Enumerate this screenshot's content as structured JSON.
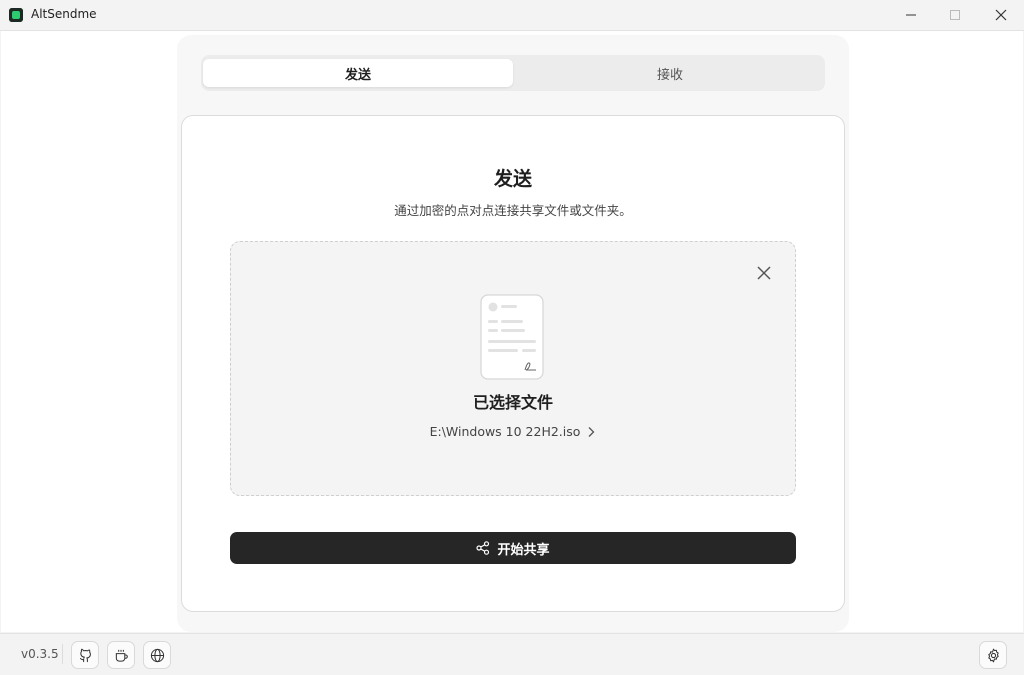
{
  "window": {
    "title": "AltSendme",
    "controls": {
      "minimize_icon": "minimize-icon",
      "maximize_icon": "maximize-icon",
      "close_icon": "close-icon"
    }
  },
  "tabs": [
    {
      "label": "发送",
      "active": true
    },
    {
      "label": "接收",
      "active": false
    }
  ],
  "send": {
    "title": "发送",
    "subtitle": "通过加密的点对点连接共享文件或文件夹。",
    "selected_label": "已选择文件",
    "file_path": "E:\\Windows 10 22H2.iso",
    "share_button": "开始共享"
  },
  "footer": {
    "version": "v0.3.5",
    "icons": [
      "github-icon",
      "coffee-icon",
      "globe-icon",
      "settings-icon"
    ]
  },
  "colors": {
    "primary_button": "#262626",
    "active_tab": "#ffffff",
    "accent": "#2ecc71"
  }
}
